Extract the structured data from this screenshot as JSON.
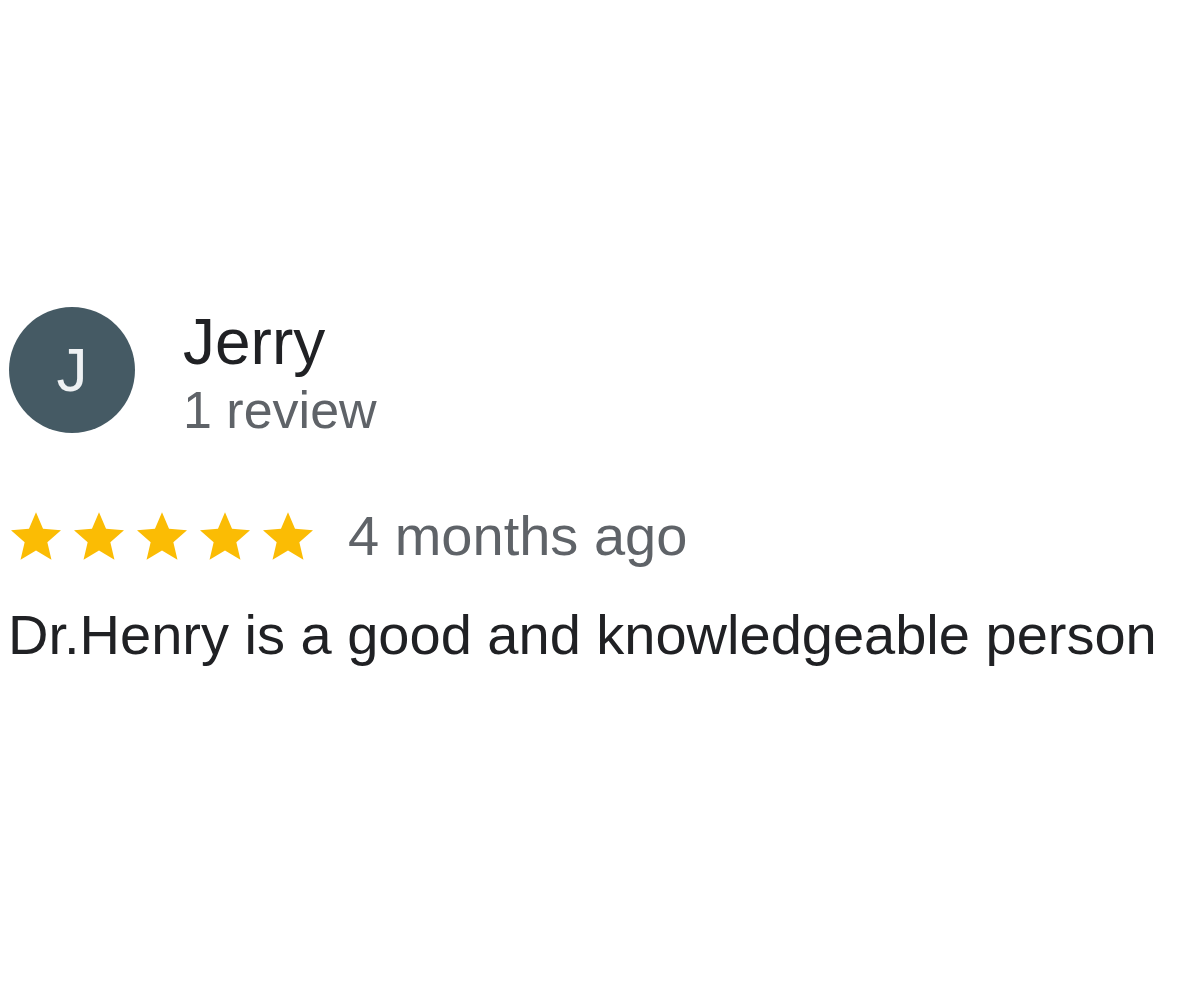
{
  "reviewer": {
    "initial": "J",
    "name": "Jerry",
    "review_count": "1 review"
  },
  "review": {
    "stars": 5,
    "time": "4 months ago",
    "text": "Dr.Henry is a good and knowledgeable person"
  }
}
